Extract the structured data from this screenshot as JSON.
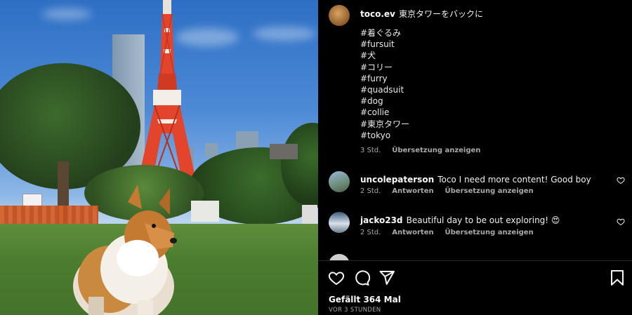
{
  "post": {
    "username": "toco.ev",
    "caption": "東京タワーをバックに",
    "hashtags": [
      "#着ぐるみ",
      "#fursuit",
      "#犬",
      "#コリー",
      "#furry",
      "#quadsuit",
      "#dog",
      "#collie",
      "#東京タワー",
      "#tokyo"
    ],
    "time": "3 Std.",
    "translate_label": "Übersetzung anzeigen"
  },
  "comments": [
    {
      "username": "uncolepaterson",
      "text": "Toco I need more content! Good boy",
      "time": "2 Std.",
      "reply_label": "Antworten",
      "translate_label": "Übersetzung anzeigen",
      "like_icon": "heart-outline-icon"
    },
    {
      "username": "jacko23d",
      "text": "Beautiful day to be out exploring! 😍",
      "time": "2 Std.",
      "reply_label": "Antworten",
      "translate_label": "Übersetzung anzeigen",
      "like_icon": "heart-outline-icon"
    }
  ],
  "actions": {
    "icons": [
      "heart-icon",
      "comment-icon",
      "share-icon",
      "bookmark-icon"
    ],
    "likes_text": "Gefällt 364 Mal",
    "time_ago": "VOR 3 STUNDEN"
  },
  "colors": {
    "background": "#000000",
    "secondary_text": "#a8a8a8",
    "tower_red": "#e2452c"
  }
}
